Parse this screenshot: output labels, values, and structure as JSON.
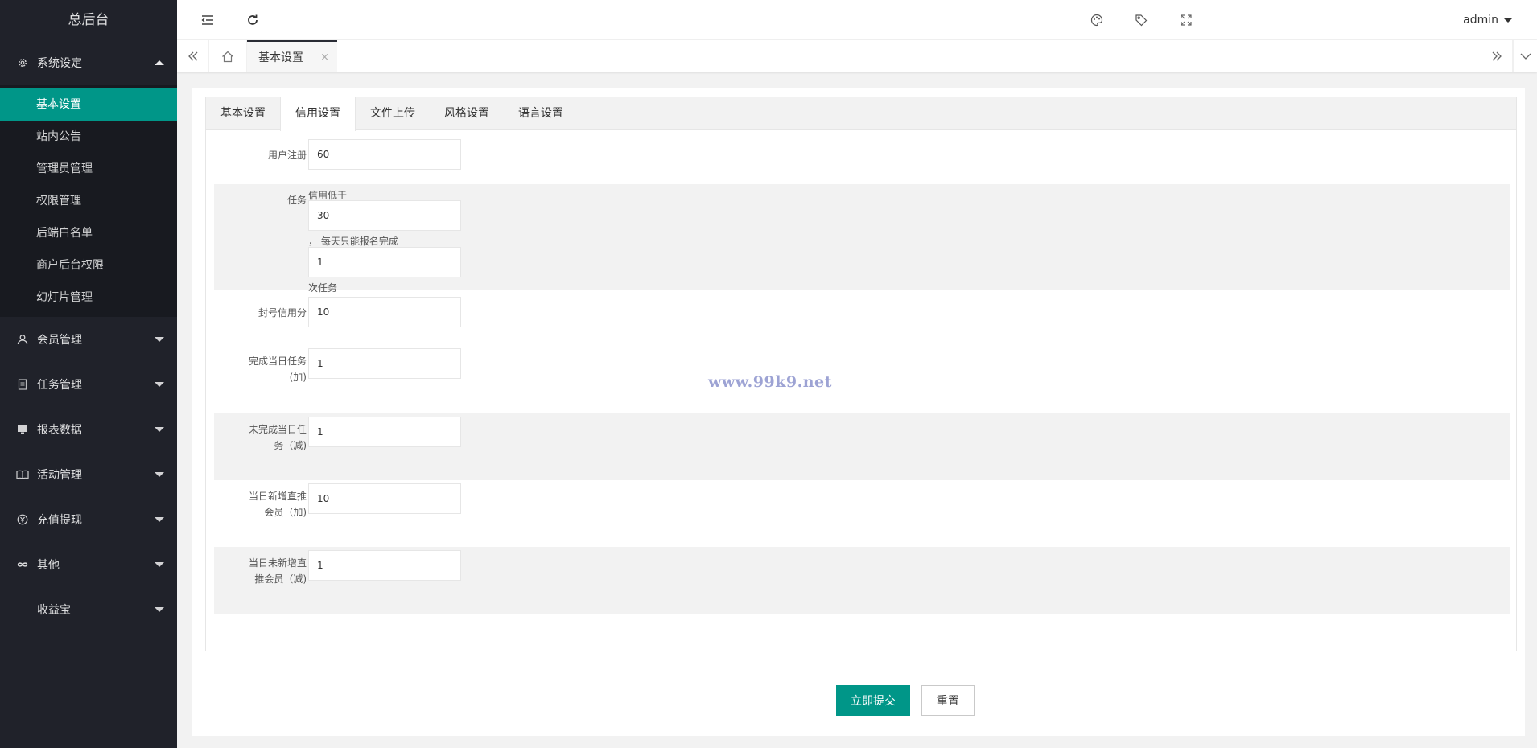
{
  "sidebar": {
    "logo": "总后台",
    "groups": [
      {
        "label": "系统设定",
        "icon": "gear-icon"
      },
      {
        "label": "会员管理",
        "icon": "user-icon"
      },
      {
        "label": "任务管理",
        "icon": "document-icon"
      },
      {
        "label": "报表数据",
        "icon": "monitor-icon"
      },
      {
        "label": "活动管理",
        "icon": "book-icon"
      },
      {
        "label": "充值提现",
        "icon": "currency-icon"
      },
      {
        "label": "其他",
        "icon": "infinity-icon"
      },
      {
        "label": "收益宝",
        "icon": ""
      }
    ],
    "submenu": [
      {
        "label": "基本设置",
        "active": true
      },
      {
        "label": "站内公告"
      },
      {
        "label": "管理员管理"
      },
      {
        "label": "权限管理"
      },
      {
        "label": "后端白名单"
      },
      {
        "label": "商户后台权限"
      },
      {
        "label": "幻灯片管理"
      }
    ]
  },
  "header": {
    "user": "admin",
    "icons": [
      "menu-fold-icon",
      "refresh-icon",
      "palette-icon",
      "tag-icon",
      "fullscreen-icon"
    ]
  },
  "tabsbar": {
    "active_tab": "基本设置",
    "close": "×"
  },
  "settings_tabs": [
    "基本设置",
    "信用设置",
    "文件上传",
    "风格设置",
    "语言设置"
  ],
  "form": {
    "user_register": {
      "label": "用户注册",
      "value": "60"
    },
    "task": {
      "label": "任务",
      "prefix": "信用低于",
      "value1": "30",
      "middle": "， 每天只能报名完成",
      "value2": "1",
      "suffix": "次任务"
    },
    "ban_credit": {
      "label": "封号信用分",
      "value": "10"
    },
    "complete_daily": {
      "label_line1": "完成当日任务",
      "label_line2": "(加)",
      "value": "1"
    },
    "incomplete_daily": {
      "label_line1": "未完成当日任",
      "label_line2": "务（减)",
      "value": "1"
    },
    "new_direct": {
      "label_line1": "当日新增直推",
      "label_line2": "会员（加)",
      "value": "10"
    },
    "no_new_direct": {
      "label_line1": "当日未新增直",
      "label_line2": "推会员（减)",
      "value": "1"
    }
  },
  "watermark": "www.99k9.net",
  "buttons": {
    "submit": "立即提交",
    "reset": "重置"
  },
  "colors": {
    "accent": "#009688",
    "sidebar": "#20222a"
  }
}
